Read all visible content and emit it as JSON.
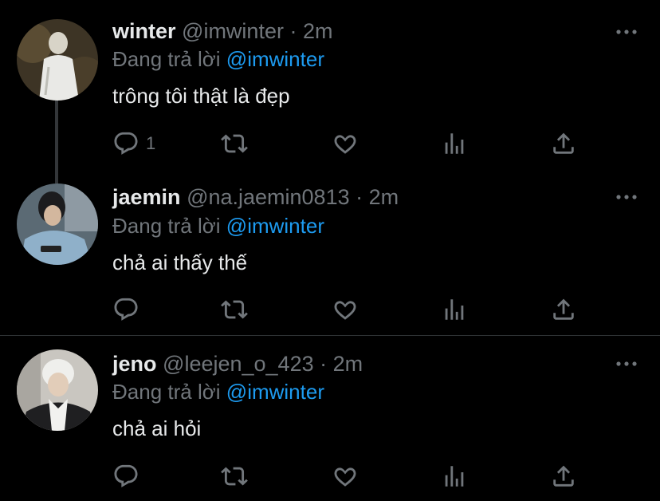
{
  "colors": {
    "background": "#000000",
    "text": "#e7e9ea",
    "muted": "#71767b",
    "mention": "#1d9bf0",
    "divider": "#2f3336"
  },
  "replying_prefix": "Đang trả lời",
  "tweets": [
    {
      "name": "winter",
      "handle": "@imwinter",
      "time": "2m",
      "replying_to": "@imwinter",
      "text": "trông tôi thật là đẹp",
      "reply_count": "1",
      "icons": [
        "reply-icon",
        "retweet-icon",
        "like-icon",
        "views-icon",
        "share-icon",
        "more-icon"
      ]
    },
    {
      "name": "jaemin",
      "handle": "@na.jaemin0813",
      "time": "2m",
      "replying_to": "@imwinter",
      "text": "chả ai thấy thế",
      "reply_count": "",
      "icons": [
        "reply-icon",
        "retweet-icon",
        "like-icon",
        "views-icon",
        "share-icon",
        "more-icon"
      ]
    },
    {
      "name": "jeno",
      "handle": "@leejen_o_423",
      "time": "2m",
      "replying_to": "@imwinter",
      "text": "chả ai hỏi",
      "reply_count": "",
      "icons": [
        "reply-icon",
        "retweet-icon",
        "like-icon",
        "views-icon",
        "share-icon",
        "more-icon"
      ]
    }
  ]
}
